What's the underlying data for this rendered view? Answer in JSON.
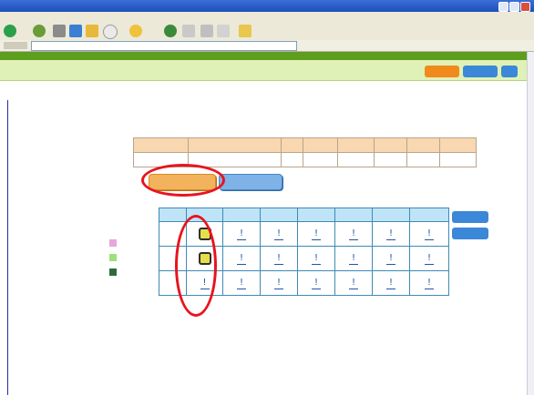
{
  "window": {
    "title": ""
  },
  "menubar": {
    "text": ""
  },
  "address": {
    "url": ""
  },
  "app": {
    "title": ""
  },
  "info": {
    "message": "",
    "btn_a": "",
    "btn_b": "",
    "btn_c": ""
  },
  "tabs": [
    {
      "label": ""
    },
    {
      "label": ""
    },
    {
      "label": ""
    },
    {
      "label": ""
    },
    {
      "label": ""
    },
    {
      "label": ""
    },
    {
      "label": ""
    }
  ],
  "reservation": {
    "headers": [
      "",
      "",
      "",
      "",
      "",
      "",
      "",
      ""
    ],
    "row": [
      "",
      "",
      "",
      "",
      "",
      "",
      "",
      ""
    ]
  },
  "buttons": {
    "primary": "",
    "secondary": ""
  },
  "schedule": {
    "headers": [
      "",
      "",
      "",
      "",
      "",
      "",
      "",
      ""
    ],
    "rows": [
      {
        "label": "",
        "cells": [
          "slot",
          "!",
          "!",
          "!",
          "!",
          "!",
          "!"
        ]
      },
      {
        "label": "",
        "cells": [
          "slot",
          "!",
          "!",
          "!",
          "!",
          "!",
          "!"
        ]
      },
      {
        "label": "",
        "cells": [
          "!",
          "!",
          "!",
          "!",
          "!",
          "!",
          "!"
        ]
      }
    ],
    "nav_prev": "",
    "nav_next": ""
  },
  "legend": [
    {
      "label": "",
      "color": "#e7a6dc"
    },
    {
      "label": "",
      "color": "#9ee07a"
    },
    {
      "label": "",
      "color": "#2e6b3c"
    }
  ],
  "colors": {
    "app_green": "#5e9e1e",
    "highlight_red": "#e8141e",
    "slot_yellow": "#e5e04a"
  }
}
